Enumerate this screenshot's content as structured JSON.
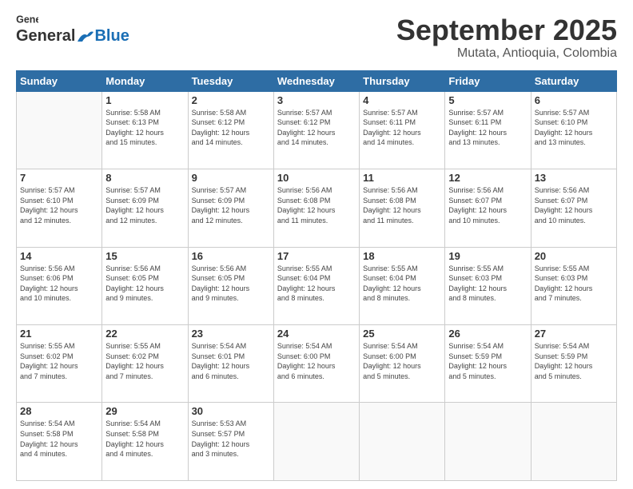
{
  "header": {
    "logo_general": "General",
    "logo_blue": "Blue",
    "month": "September 2025",
    "location": "Mutata, Antioquia, Colombia"
  },
  "weekdays": [
    "Sunday",
    "Monday",
    "Tuesday",
    "Wednesday",
    "Thursday",
    "Friday",
    "Saturday"
  ],
  "weeks": [
    [
      {
        "day": "",
        "info": ""
      },
      {
        "day": "1",
        "info": "Sunrise: 5:58 AM\nSunset: 6:13 PM\nDaylight: 12 hours\nand 15 minutes."
      },
      {
        "day": "2",
        "info": "Sunrise: 5:58 AM\nSunset: 6:12 PM\nDaylight: 12 hours\nand 14 minutes."
      },
      {
        "day": "3",
        "info": "Sunrise: 5:57 AM\nSunset: 6:12 PM\nDaylight: 12 hours\nand 14 minutes."
      },
      {
        "day": "4",
        "info": "Sunrise: 5:57 AM\nSunset: 6:11 PM\nDaylight: 12 hours\nand 14 minutes."
      },
      {
        "day": "5",
        "info": "Sunrise: 5:57 AM\nSunset: 6:11 PM\nDaylight: 12 hours\nand 13 minutes."
      },
      {
        "day": "6",
        "info": "Sunrise: 5:57 AM\nSunset: 6:10 PM\nDaylight: 12 hours\nand 13 minutes."
      }
    ],
    [
      {
        "day": "7",
        "info": "Sunrise: 5:57 AM\nSunset: 6:10 PM\nDaylight: 12 hours\nand 12 minutes."
      },
      {
        "day": "8",
        "info": "Sunrise: 5:57 AM\nSunset: 6:09 PM\nDaylight: 12 hours\nand 12 minutes."
      },
      {
        "day": "9",
        "info": "Sunrise: 5:57 AM\nSunset: 6:09 PM\nDaylight: 12 hours\nand 12 minutes."
      },
      {
        "day": "10",
        "info": "Sunrise: 5:56 AM\nSunset: 6:08 PM\nDaylight: 12 hours\nand 11 minutes."
      },
      {
        "day": "11",
        "info": "Sunrise: 5:56 AM\nSunset: 6:08 PM\nDaylight: 12 hours\nand 11 minutes."
      },
      {
        "day": "12",
        "info": "Sunrise: 5:56 AM\nSunset: 6:07 PM\nDaylight: 12 hours\nand 10 minutes."
      },
      {
        "day": "13",
        "info": "Sunrise: 5:56 AM\nSunset: 6:07 PM\nDaylight: 12 hours\nand 10 minutes."
      }
    ],
    [
      {
        "day": "14",
        "info": "Sunrise: 5:56 AM\nSunset: 6:06 PM\nDaylight: 12 hours\nand 10 minutes."
      },
      {
        "day": "15",
        "info": "Sunrise: 5:56 AM\nSunset: 6:05 PM\nDaylight: 12 hours\nand 9 minutes."
      },
      {
        "day": "16",
        "info": "Sunrise: 5:56 AM\nSunset: 6:05 PM\nDaylight: 12 hours\nand 9 minutes."
      },
      {
        "day": "17",
        "info": "Sunrise: 5:55 AM\nSunset: 6:04 PM\nDaylight: 12 hours\nand 8 minutes."
      },
      {
        "day": "18",
        "info": "Sunrise: 5:55 AM\nSunset: 6:04 PM\nDaylight: 12 hours\nand 8 minutes."
      },
      {
        "day": "19",
        "info": "Sunrise: 5:55 AM\nSunset: 6:03 PM\nDaylight: 12 hours\nand 8 minutes."
      },
      {
        "day": "20",
        "info": "Sunrise: 5:55 AM\nSunset: 6:03 PM\nDaylight: 12 hours\nand 7 minutes."
      }
    ],
    [
      {
        "day": "21",
        "info": "Sunrise: 5:55 AM\nSunset: 6:02 PM\nDaylight: 12 hours\nand 7 minutes."
      },
      {
        "day": "22",
        "info": "Sunrise: 5:55 AM\nSunset: 6:02 PM\nDaylight: 12 hours\nand 7 minutes."
      },
      {
        "day": "23",
        "info": "Sunrise: 5:54 AM\nSunset: 6:01 PM\nDaylight: 12 hours\nand 6 minutes."
      },
      {
        "day": "24",
        "info": "Sunrise: 5:54 AM\nSunset: 6:00 PM\nDaylight: 12 hours\nand 6 minutes."
      },
      {
        "day": "25",
        "info": "Sunrise: 5:54 AM\nSunset: 6:00 PM\nDaylight: 12 hours\nand 5 minutes."
      },
      {
        "day": "26",
        "info": "Sunrise: 5:54 AM\nSunset: 5:59 PM\nDaylight: 12 hours\nand 5 minutes."
      },
      {
        "day": "27",
        "info": "Sunrise: 5:54 AM\nSunset: 5:59 PM\nDaylight: 12 hours\nand 5 minutes."
      }
    ],
    [
      {
        "day": "28",
        "info": "Sunrise: 5:54 AM\nSunset: 5:58 PM\nDaylight: 12 hours\nand 4 minutes."
      },
      {
        "day": "29",
        "info": "Sunrise: 5:54 AM\nSunset: 5:58 PM\nDaylight: 12 hours\nand 4 minutes."
      },
      {
        "day": "30",
        "info": "Sunrise: 5:53 AM\nSunset: 5:57 PM\nDaylight: 12 hours\nand 3 minutes."
      },
      {
        "day": "",
        "info": ""
      },
      {
        "day": "",
        "info": ""
      },
      {
        "day": "",
        "info": ""
      },
      {
        "day": "",
        "info": ""
      }
    ]
  ]
}
